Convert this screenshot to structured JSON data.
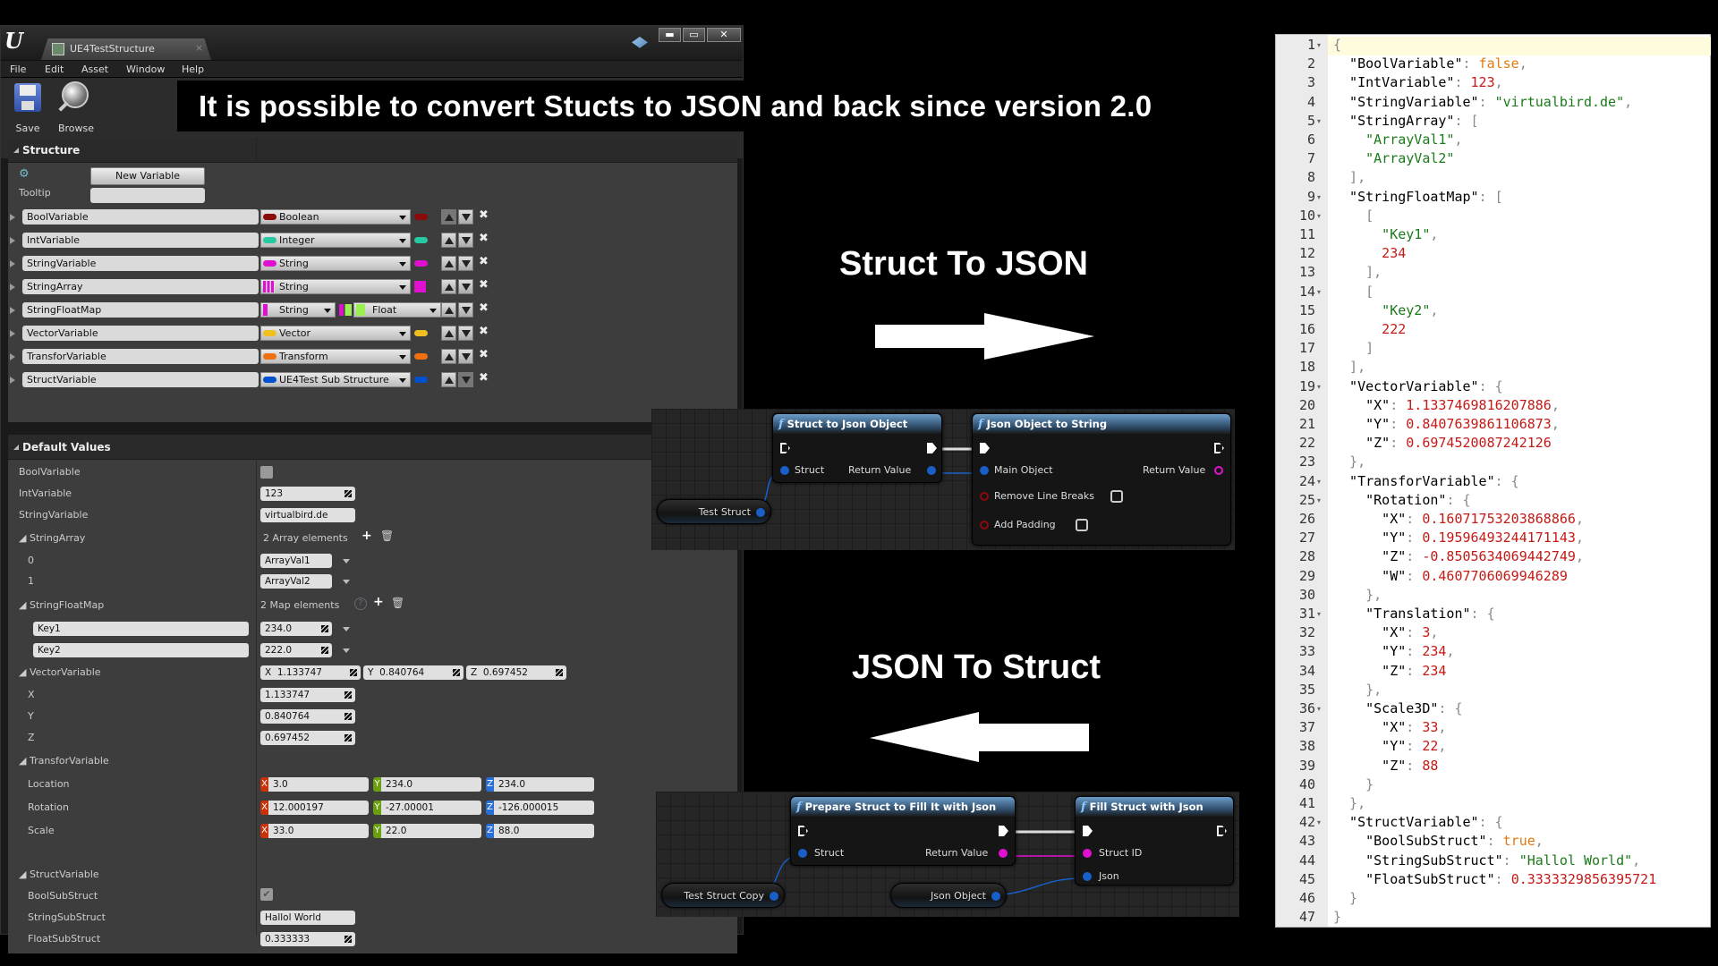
{
  "window": {
    "tab_title": "UE4TestStructure",
    "tab_close": "×",
    "controls": {
      "minimize": "▬",
      "maximize": "▭",
      "close": "✕"
    }
  },
  "menu": [
    "File",
    "Edit",
    "Asset",
    "Window",
    "Help"
  ],
  "toolbar": {
    "save_label": "Save",
    "browse_label": "Browse"
  },
  "banner": "It is possible to convert Stucts to JSON and back since version 2.0",
  "structure": {
    "title": "Structure",
    "new_variable_label": "New Variable",
    "tooltip_label": "Tooltip",
    "tooltip_value": "",
    "variables": [
      {
        "name": "BoolVariable",
        "type": "Boolean",
        "color": "#8b0a0a",
        "kind": "single"
      },
      {
        "name": "IntVariable",
        "type": "Integer",
        "color": "#27c9a0",
        "kind": "single"
      },
      {
        "name": "StringVariable",
        "type": "String",
        "color": "#e010d0",
        "kind": "single"
      },
      {
        "name": "StringArray",
        "type": "String",
        "color": "#e010d0",
        "kind": "array"
      },
      {
        "name": "StringFloatMap",
        "type": "String",
        "value_type": "Float",
        "color": "#e010d0",
        "value_color": "#9af050",
        "kind": "map"
      },
      {
        "name": "VectorVariable",
        "type": "Vector",
        "color": "#f0c020",
        "kind": "single"
      },
      {
        "name": "TransforVariable",
        "type": "Transform",
        "color": "#f07010",
        "kind": "single"
      },
      {
        "name": "StructVariable",
        "type": "UE4Test Sub Structure",
        "color": "#0050d0",
        "kind": "single"
      }
    ],
    "remove_label": "✖"
  },
  "defaults": {
    "title": "Default Values",
    "bool_label": "BoolVariable",
    "bool_checked": false,
    "int_label": "IntVariable",
    "int_value": "123",
    "string_label": "StringVariable",
    "string_value": "virtualbird.de",
    "array_label": "StringArray",
    "array_count": "2 Array elements",
    "array_items": [
      {
        "index": "0",
        "value": "ArrayVal1"
      },
      {
        "index": "1",
        "value": "ArrayVal2"
      }
    ],
    "map_label": "StringFloatMap",
    "map_count": "2 Map elements",
    "map_items": [
      {
        "key": "Key1",
        "value": "234.0"
      },
      {
        "key": "Key2",
        "value": "222.0"
      }
    ],
    "vector_label": "VectorVariable",
    "vector_summary": {
      "x": "1.133747",
      "y": "0.840764",
      "z": "0.697452"
    },
    "vector_x_label": "X",
    "vector_y_label": "Y",
    "vector_z_label": "Z",
    "transform_label": "TransforVariable",
    "transform_rows": [
      {
        "label": "Location",
        "x": "3.0",
        "y": "234.0",
        "z": "234.0"
      },
      {
        "label": "Rotation",
        "x": "12.000197",
        "y": "-27.00001",
        "z": "-126.000015"
      },
      {
        "label": "Scale",
        "x": "33.0",
        "y": "22.0",
        "z": "88.0"
      }
    ],
    "struct_label": "StructVariable",
    "bool_sub_label": "BoolSubStruct",
    "bool_sub_checked": true,
    "string_sub_label": "StringSubStruct",
    "string_sub_value": "Hallol World",
    "float_sub_label": "FloatSubStruct",
    "float_sub_value": "0.333333",
    "axis": {
      "x": "X",
      "y": "Y",
      "z": "Z"
    }
  },
  "struct_to_json": {
    "label": "Struct To JSON",
    "node1": {
      "title": "Struct to Json Object",
      "in_pin": "Struct",
      "out_pin": "Return Value"
    },
    "node2": {
      "title": "Json Object to String",
      "in_pin": "Main Object",
      "out_pin": "Return Value",
      "opt1": "Remove Line Breaks",
      "opt2": "Add Padding"
    },
    "var_node": "Test Struct"
  },
  "json_to_struct": {
    "label": "JSON To Struct",
    "node1": {
      "title": "Prepare Struct to Fill It with Json",
      "in_pin": "Struct",
      "out_pin": "Return Value"
    },
    "node2": {
      "title": "Fill Struct with Json",
      "pin1": "Struct ID",
      "pin2": "Json"
    },
    "var_node1": "Test Struct Copy",
    "var_node2": "Json Object"
  },
  "json_editor": {
    "lines": [
      [
        [
          "p",
          "{"
        ]
      ],
      [
        [
          "k",
          "  \"BoolVariable\""
        ],
        [
          "p",
          ": "
        ],
        [
          "b",
          "false"
        ],
        [
          "p",
          ","
        ]
      ],
      [
        [
          "k",
          "  \"IntVariable\""
        ],
        [
          "p",
          ": "
        ],
        [
          "n",
          "123"
        ],
        [
          "p",
          ","
        ]
      ],
      [
        [
          "k",
          "  \"StringVariable\""
        ],
        [
          "p",
          ": "
        ],
        [
          "s",
          "\"virtualbird.de\""
        ],
        [
          "p",
          ","
        ]
      ],
      [
        [
          "k",
          "  \"StringArray\""
        ],
        [
          "p",
          ": ["
        ]
      ],
      [
        [
          "s",
          "    \"ArrayVal1\""
        ],
        [
          "p",
          ","
        ]
      ],
      [
        [
          "s",
          "    \"ArrayVal2\""
        ]
      ],
      [
        [
          "p",
          "  ],"
        ]
      ],
      [
        [
          "k",
          "  \"StringFloatMap\""
        ],
        [
          "p",
          ": ["
        ]
      ],
      [
        [
          "p",
          "    ["
        ]
      ],
      [
        [
          "s",
          "      \"Key1\""
        ],
        [
          "p",
          ","
        ]
      ],
      [
        [
          "n",
          "      234"
        ]
      ],
      [
        [
          "p",
          "    ],"
        ]
      ],
      [
        [
          "p",
          "    ["
        ]
      ],
      [
        [
          "s",
          "      \"Key2\""
        ],
        [
          "p",
          ","
        ]
      ],
      [
        [
          "n",
          "      222"
        ]
      ],
      [
        [
          "p",
          "    ]"
        ]
      ],
      [
        [
          "p",
          "  ],"
        ]
      ],
      [
        [
          "k",
          "  \"VectorVariable\""
        ],
        [
          "p",
          ": {"
        ]
      ],
      [
        [
          "k",
          "    \"X\""
        ],
        [
          "p",
          ": "
        ],
        [
          "n",
          "1.1337469816207886"
        ],
        [
          "p",
          ","
        ]
      ],
      [
        [
          "k",
          "    \"Y\""
        ],
        [
          "p",
          ": "
        ],
        [
          "n",
          "0.8407639861106873"
        ],
        [
          "p",
          ","
        ]
      ],
      [
        [
          "k",
          "    \"Z\""
        ],
        [
          "p",
          ": "
        ],
        [
          "n",
          "0.6974520087242126"
        ]
      ],
      [
        [
          "p",
          "  },"
        ]
      ],
      [
        [
          "k",
          "  \"TransforVariable\""
        ],
        [
          "p",
          ": {"
        ]
      ],
      [
        [
          "k",
          "    \"Rotation\""
        ],
        [
          "p",
          ": {"
        ]
      ],
      [
        [
          "k",
          "      \"X\""
        ],
        [
          "p",
          ": "
        ],
        [
          "n",
          "0.16071753203868866"
        ],
        [
          "p",
          ","
        ]
      ],
      [
        [
          "k",
          "      \"Y\""
        ],
        [
          "p",
          ": "
        ],
        [
          "n",
          "0.19596493244171143"
        ],
        [
          "p",
          ","
        ]
      ],
      [
        [
          "k",
          "      \"Z\""
        ],
        [
          "p",
          ": "
        ],
        [
          "n",
          "-0.8505634069442749"
        ],
        [
          "p",
          ","
        ]
      ],
      [
        [
          "k",
          "      \"W\""
        ],
        [
          "p",
          ": "
        ],
        [
          "n",
          "0.4607706069946289"
        ]
      ],
      [
        [
          "p",
          "    },"
        ]
      ],
      [
        [
          "k",
          "    \"Translation\""
        ],
        [
          "p",
          ": {"
        ]
      ],
      [
        [
          "k",
          "      \"X\""
        ],
        [
          "p",
          ": "
        ],
        [
          "n",
          "3"
        ],
        [
          "p",
          ","
        ]
      ],
      [
        [
          "k",
          "      \"Y\""
        ],
        [
          "p",
          ": "
        ],
        [
          "n",
          "234"
        ],
        [
          "p",
          ","
        ]
      ],
      [
        [
          "k",
          "      \"Z\""
        ],
        [
          "p",
          ": "
        ],
        [
          "n",
          "234"
        ]
      ],
      [
        [
          "p",
          "    },"
        ]
      ],
      [
        [
          "k",
          "    \"Scale3D\""
        ],
        [
          "p",
          ": {"
        ]
      ],
      [
        [
          "k",
          "      \"X\""
        ],
        [
          "p",
          ": "
        ],
        [
          "n",
          "33"
        ],
        [
          "p",
          ","
        ]
      ],
      [
        [
          "k",
          "      \"Y\""
        ],
        [
          "p",
          ": "
        ],
        [
          "n",
          "22"
        ],
        [
          "p",
          ","
        ]
      ],
      [
        [
          "k",
          "      \"Z\""
        ],
        [
          "p",
          ": "
        ],
        [
          "n",
          "88"
        ]
      ],
      [
        [
          "p",
          "    }"
        ]
      ],
      [
        [
          "p",
          "  },"
        ]
      ],
      [
        [
          "k",
          "  \"StructVariable\""
        ],
        [
          "p",
          ": {"
        ]
      ],
      [
        [
          "k",
          "    \"BoolSubStruct\""
        ],
        [
          "p",
          ": "
        ],
        [
          "b",
          "true"
        ],
        [
          "p",
          ","
        ]
      ],
      [
        [
          "k",
          "    \"StringSubStruct\""
        ],
        [
          "p",
          ": "
        ],
        [
          "s",
          "\"Hallol World\""
        ],
        [
          "p",
          ","
        ]
      ],
      [
        [
          "k",
          "    \"FloatSubStruct\""
        ],
        [
          "p",
          ": "
        ],
        [
          "n",
          "0.3333329856395721"
        ]
      ],
      [
        [
          "p",
          "  }"
        ]
      ],
      [
        [
          "p",
          "}"
        ]
      ]
    ],
    "fold_lines": [
      1,
      5,
      9,
      10,
      14,
      19,
      24,
      25,
      31,
      36,
      42
    ],
    "fold_glyph": "▾"
  }
}
